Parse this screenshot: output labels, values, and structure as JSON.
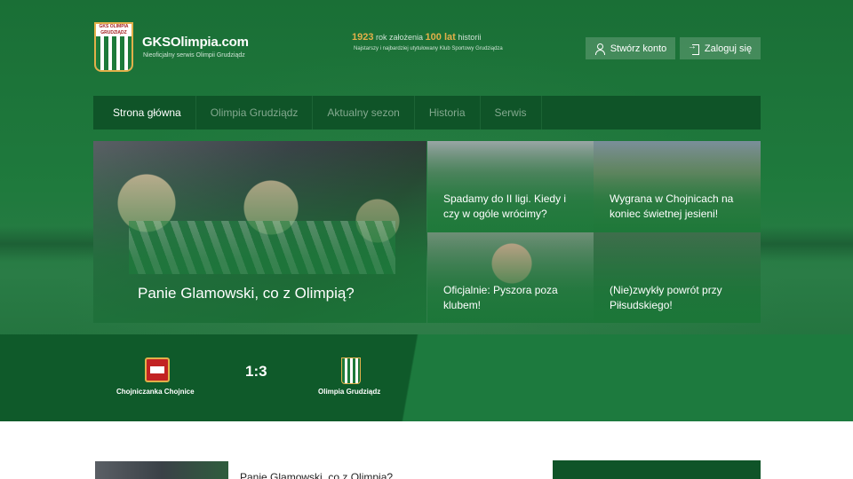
{
  "header": {
    "logo_text": "GKS OLIMPIA GRUDZIĄDZ",
    "site_title": "GKSOlimpia.com",
    "site_subtitle": "Nieoficjalny serwis Olimpii Grudziądz",
    "tagline": {
      "year": "1923",
      "year_text": "rok założenia",
      "years": "100 lat",
      "years_text": "historii",
      "subtitle": "Najstarszy i najbardziej utytułowany Klub Sportowy Grudziądza"
    },
    "register_label": "Stwórz konto",
    "login_label": "Zaloguj się"
  },
  "nav": {
    "items": [
      {
        "label": "Strona główna"
      },
      {
        "label": "Olimpia Grudziądz"
      },
      {
        "label": "Aktualny sezon"
      },
      {
        "label": "Historia"
      },
      {
        "label": "Serwis"
      }
    ]
  },
  "featured": {
    "main": {
      "title": "Panie Glamowski, co z Olimpią?"
    },
    "tiles": [
      {
        "title": "Spadamy do II ligi. Kiedy i czy w ogóle wrócimy?"
      },
      {
        "title": "Wygrana w Chojnicach na koniec świetnej jesieni!"
      },
      {
        "title": "Oficjalnie: Pyszora poza klubem!"
      },
      {
        "title": "(Nie)zwykły powrót przy Piłsudskiego!"
      }
    ]
  },
  "match": {
    "home": "Chojniczanka Chojnice",
    "away": "Olimpia Grudziądz",
    "score": "1:3"
  },
  "latest": {
    "title": "Panie Glamowski, co z Olimpią?"
  },
  "colors": {
    "brand_green": "#1d7a3a",
    "nav_bg": "#0f5428",
    "accent_gold": "#e2b04a"
  }
}
